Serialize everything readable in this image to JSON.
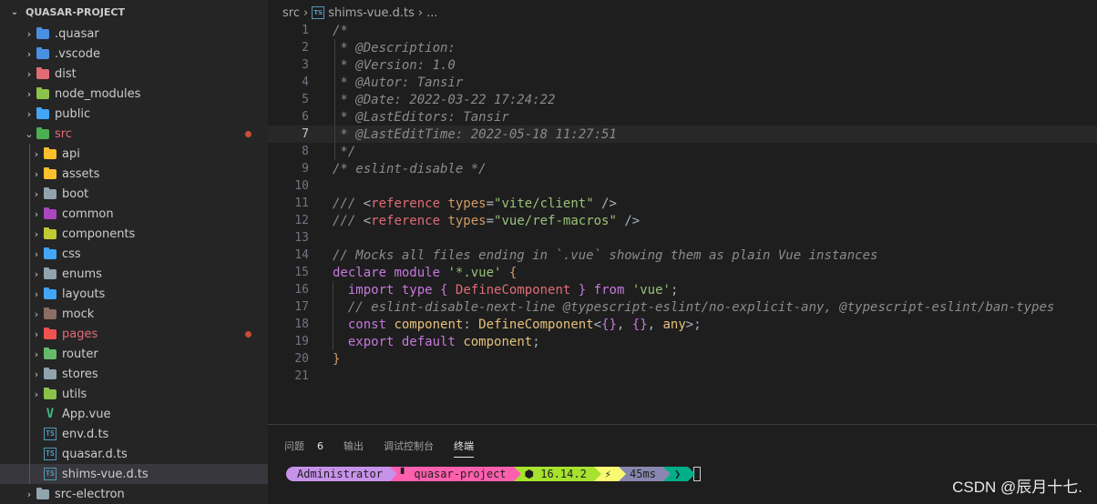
{
  "explorer": {
    "title": "QUASAR-PROJECT",
    "items": [
      {
        "label": ".quasar",
        "kind": "folder",
        "icon": "quasar-folder-icon",
        "color": "#4a90e2",
        "depth": 1,
        "expanded": false
      },
      {
        "label": ".vscode",
        "kind": "folder",
        "icon": "vscode-folder-icon",
        "color": "#4a90e2",
        "depth": 1,
        "expanded": false
      },
      {
        "label": "dist",
        "kind": "folder",
        "icon": "dist-folder-icon",
        "color": "#e06c75",
        "depth": 1,
        "expanded": false
      },
      {
        "label": "node_modules",
        "kind": "folder",
        "icon": "node-modules-folder-icon",
        "color": "#8bc34a",
        "depth": 1,
        "expanded": false
      },
      {
        "label": "public",
        "kind": "folder",
        "icon": "public-folder-icon",
        "color": "#42a5f5",
        "depth": 1,
        "expanded": false
      },
      {
        "label": "src",
        "kind": "folder",
        "icon": "src-folder-icon",
        "color": "#4caf50",
        "depth": 1,
        "expanded": true,
        "modified": true,
        "label_color": "#e06c75"
      },
      {
        "label": "api",
        "kind": "folder",
        "icon": "api-folder-icon",
        "color": "#fbc02d",
        "depth": 2,
        "expanded": false
      },
      {
        "label": "assets",
        "kind": "folder",
        "icon": "assets-folder-icon",
        "color": "#fbc02d",
        "depth": 2,
        "expanded": false
      },
      {
        "label": "boot",
        "kind": "folder",
        "icon": "boot-folder-icon",
        "color": "#90a4ae",
        "depth": 2,
        "expanded": false
      },
      {
        "label": "common",
        "kind": "folder",
        "icon": "common-folder-icon",
        "color": "#ab47bc",
        "depth": 2,
        "expanded": false
      },
      {
        "label": "components",
        "kind": "folder",
        "icon": "components-folder-icon",
        "color": "#c0ca33",
        "depth": 2,
        "expanded": false
      },
      {
        "label": "css",
        "kind": "folder",
        "icon": "css-folder-icon",
        "color": "#42a5f5",
        "depth": 2,
        "expanded": false
      },
      {
        "label": "enums",
        "kind": "folder",
        "icon": "enums-folder-icon",
        "color": "#90a4ae",
        "depth": 2,
        "expanded": false
      },
      {
        "label": "layouts",
        "kind": "folder",
        "icon": "layouts-folder-icon",
        "color": "#42a5f5",
        "depth": 2,
        "expanded": false
      },
      {
        "label": "mock",
        "kind": "folder",
        "icon": "mock-folder-icon",
        "color": "#8d6e63",
        "depth": 2,
        "expanded": false
      },
      {
        "label": "pages",
        "kind": "folder",
        "icon": "pages-folder-icon",
        "color": "#ef5350",
        "depth": 2,
        "expanded": false,
        "modified": true,
        "label_color": "#e06c75"
      },
      {
        "label": "router",
        "kind": "folder",
        "icon": "router-folder-icon",
        "color": "#66bb6a",
        "depth": 2,
        "expanded": false
      },
      {
        "label": "stores",
        "kind": "folder",
        "icon": "stores-folder-icon",
        "color": "#90a4ae",
        "depth": 2,
        "expanded": false
      },
      {
        "label": "utils",
        "kind": "folder",
        "icon": "utils-folder-icon",
        "color": "#8bc34a",
        "depth": 2,
        "expanded": false
      },
      {
        "label": "App.vue",
        "kind": "vue",
        "icon": "vue-file-icon",
        "color": "#41b883",
        "depth": 2
      },
      {
        "label": "env.d.ts",
        "kind": "ts",
        "icon": "typescript-def-file-icon",
        "color": "#519aba",
        "depth": 2
      },
      {
        "label": "quasar.d.ts",
        "kind": "ts",
        "icon": "typescript-def-file-icon",
        "color": "#519aba",
        "depth": 2
      },
      {
        "label": "shims-vue.d.ts",
        "kind": "ts",
        "icon": "typescript-def-file-icon",
        "color": "#519aba",
        "depth": 2,
        "selected": true
      },
      {
        "label": "src-electron",
        "kind": "folder",
        "icon": "src-electron-folder-icon",
        "color": "#90a4ae",
        "depth": 1,
        "expanded": false
      }
    ]
  },
  "breadcrumb": {
    "parts": [
      "src",
      "shims-vue.d.ts",
      "..."
    ]
  },
  "editor": {
    "current_line": 7,
    "lines": [
      [
        [
          "c",
          "/*"
        ]
      ],
      [
        [
          "c",
          " * @Description:"
        ]
      ],
      [
        [
          "c",
          " * @Version: 1.0"
        ]
      ],
      [
        [
          "c",
          " * @Autor: Tansir"
        ]
      ],
      [
        [
          "c",
          " * @Date: 2022-03-22 17:24:22"
        ]
      ],
      [
        [
          "c",
          " * @LastEditors: Tansir"
        ]
      ],
      [
        [
          "c",
          " * @LastEditTime: 2022-05-18 11:27:51"
        ]
      ],
      [
        [
          "c",
          " */"
        ]
      ],
      [
        [
          "c",
          "/* eslint-disable */"
        ]
      ],
      [],
      [
        [
          "c",
          "/// "
        ],
        [
          "plain",
          "<"
        ],
        [
          "tag",
          "reference"
        ],
        [
          "plain",
          " "
        ],
        [
          "attr",
          "types"
        ],
        [
          "plain",
          "="
        ],
        [
          "str",
          "\"vite/client\""
        ],
        [
          "plain",
          " />"
        ]
      ],
      [
        [
          "c",
          "/// "
        ],
        [
          "plain",
          "<"
        ],
        [
          "tag",
          "reference"
        ],
        [
          "plain",
          " "
        ],
        [
          "attr",
          "types"
        ],
        [
          "plain",
          "="
        ],
        [
          "str",
          "\"vue/ref-macros\""
        ],
        [
          "plain",
          " />"
        ]
      ],
      [],
      [
        [
          "c",
          "// Mocks all files ending in `.vue` showing them as plain Vue instances"
        ]
      ],
      [
        [
          "kw",
          "declare"
        ],
        [
          "plain",
          " "
        ],
        [
          "kw",
          "module"
        ],
        [
          "plain",
          " "
        ],
        [
          "str",
          "'*.vue'"
        ],
        [
          "plain",
          " "
        ],
        [
          "brk",
          "{"
        ]
      ],
      [
        [
          "plain",
          "  "
        ],
        [
          "kw",
          "import"
        ],
        [
          "plain",
          " "
        ],
        [
          "kw",
          "type"
        ],
        [
          "plain",
          " "
        ],
        [
          "brk2",
          "{"
        ],
        [
          "plain",
          " "
        ],
        [
          "tag",
          "DefineComponent"
        ],
        [
          "plain",
          " "
        ],
        [
          "brk2",
          "}"
        ],
        [
          "plain",
          " "
        ],
        [
          "kw",
          "from"
        ],
        [
          "plain",
          " "
        ],
        [
          "str",
          "'vue'"
        ],
        [
          "plain",
          ";"
        ]
      ],
      [
        [
          "plain",
          "  "
        ],
        [
          "c",
          "// eslint-disable-next-line @typescript-eslint/no-explicit-any, @typescript-eslint/ban-types"
        ]
      ],
      [
        [
          "plain",
          "  "
        ],
        [
          "kw",
          "const"
        ],
        [
          "plain",
          " "
        ],
        [
          "typ",
          "component"
        ],
        [
          "plain",
          ": "
        ],
        [
          "typ",
          "DefineComponent"
        ],
        [
          "plain",
          "<"
        ],
        [
          "brk2",
          "{}"
        ],
        [
          "plain",
          ", "
        ],
        [
          "brk2",
          "{}"
        ],
        [
          "plain",
          ", "
        ],
        [
          "typ",
          "any"
        ],
        [
          "plain",
          ">;"
        ]
      ],
      [
        [
          "plain",
          "  "
        ],
        [
          "kw",
          "export"
        ],
        [
          "plain",
          " "
        ],
        [
          "kw",
          "default"
        ],
        [
          "plain",
          " "
        ],
        [
          "typ",
          "component"
        ],
        [
          "plain",
          ";"
        ]
      ],
      [
        [
          "brk",
          "}"
        ]
      ],
      []
    ]
  },
  "panel": {
    "tabs": [
      {
        "label": "问题",
        "count": "6",
        "active": false
      },
      {
        "label": "输出",
        "active": false
      },
      {
        "label": "调试控制台",
        "active": false
      },
      {
        "label": "终端",
        "active": true
      }
    ]
  },
  "terminal": {
    "segments": [
      {
        "text": "Administrator",
        "color": "#c792ea"
      },
      {
        "text": "▘ quasar-project",
        "color": "#ff5faf"
      },
      {
        "text": "⬢ 16.14.2",
        "color": "#a6e22e"
      },
      {
        "text": "⚡",
        "color": "#f9f871"
      },
      {
        "text": "45ms",
        "color": "#8787af"
      },
      {
        "text": "❯",
        "color": "#00af87"
      }
    ]
  },
  "watermark": "CSDN @辰月十七."
}
